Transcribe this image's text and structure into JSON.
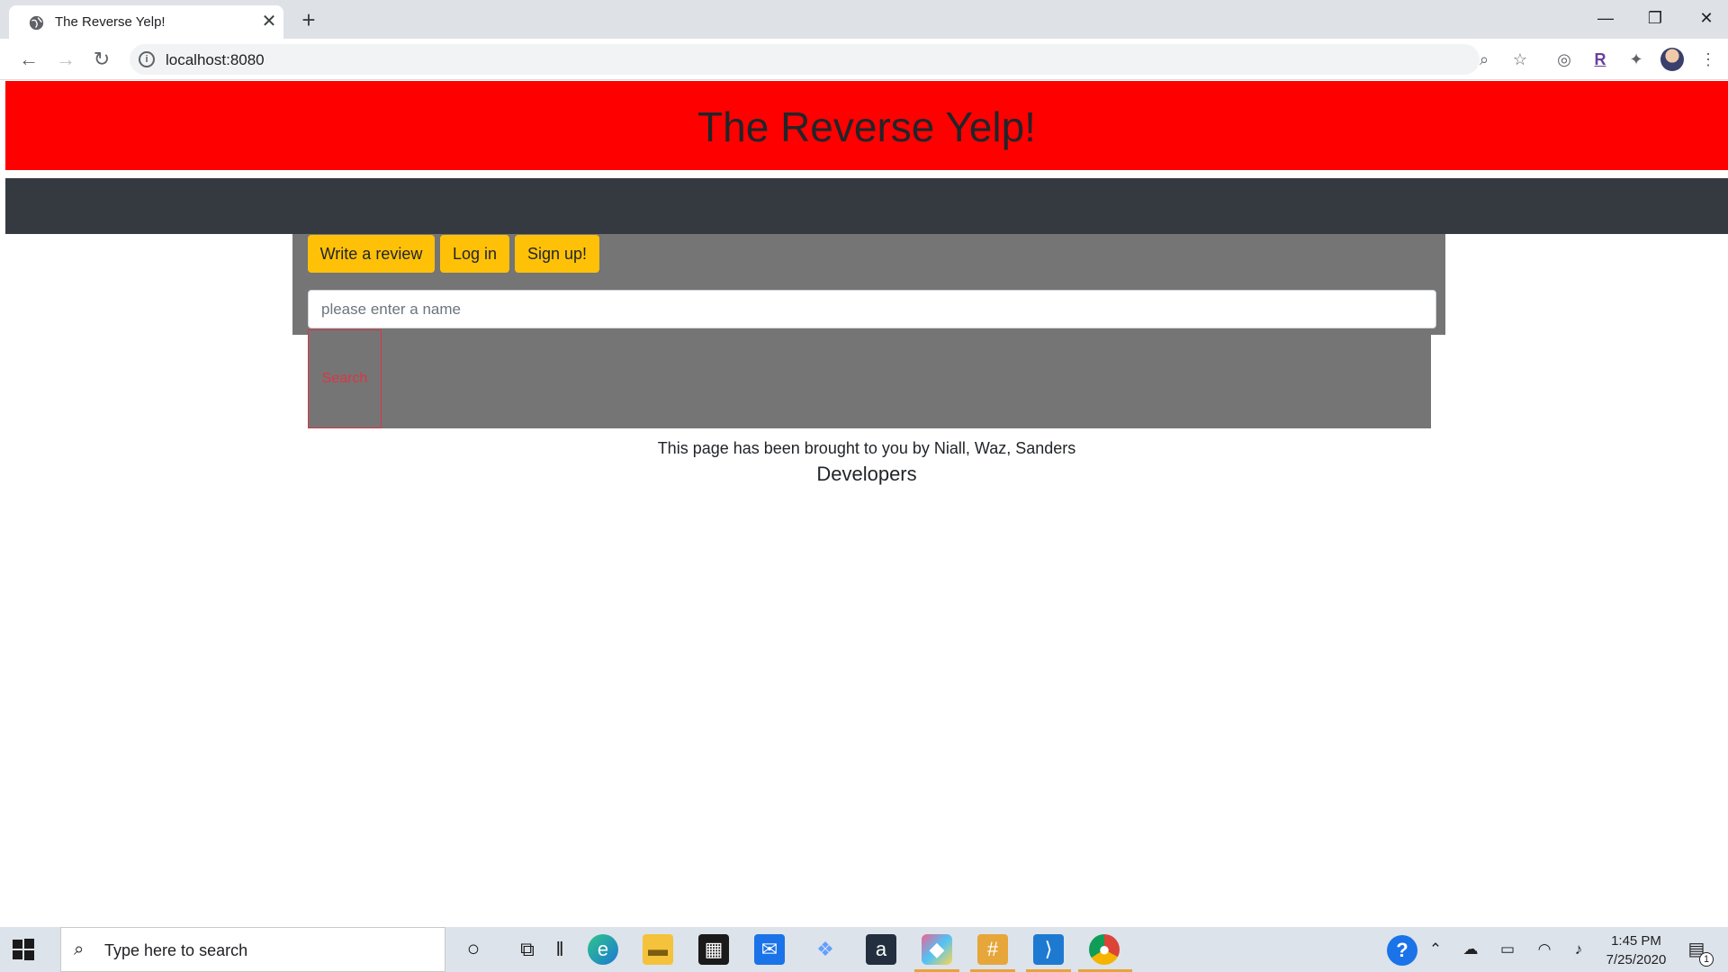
{
  "browser": {
    "tab_title": "The Reverse Yelp!",
    "tab_close": "✕",
    "new_tab": "+",
    "url": "localhost:8080",
    "window_controls": {
      "minimize": "—",
      "maximize": "❐",
      "close": "✕"
    },
    "ext_r_label": "R"
  },
  "page": {
    "title": "The Reverse Yelp!",
    "buttons": {
      "write_review": "Write a review",
      "log_in": "Log in",
      "sign_up": "Sign up!"
    },
    "search": {
      "placeholder": "please enter a name",
      "button_label": "Search"
    },
    "footer": {
      "credit": "This page has been brought to you by Niall, Waz, Sanders",
      "heading": "Developers"
    }
  },
  "taskbar": {
    "search_placeholder": "Type here to search",
    "time": "1:45 PM",
    "date": "7/25/2020",
    "notification_count": "1",
    "icons": [
      "cortana-icon",
      "task-view-icon",
      "edge-icon",
      "file-explorer-icon",
      "store-icon",
      "mail-icon",
      "dropbox-icon",
      "amazon-icon",
      "git-icon",
      "slack-icon",
      "vscode-icon",
      "chrome-icon"
    ]
  },
  "colors": {
    "header": "#ff0000",
    "navbar": "#343a40",
    "panel": "#757575",
    "button": "#ffc107",
    "search_outline": "#dc3545"
  }
}
